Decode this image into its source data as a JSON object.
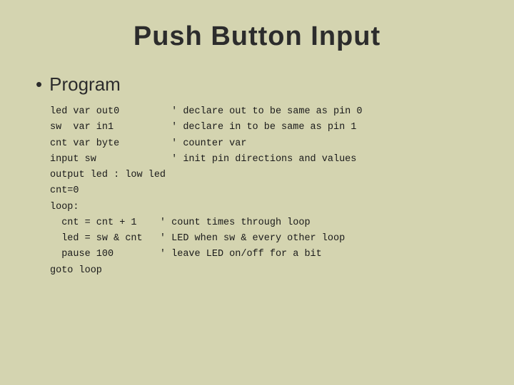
{
  "slide": {
    "title": "Push Button Input",
    "bullet": {
      "label": "Program"
    },
    "code_lines": [
      "led var out0         ' declare out to be same as pin 0",
      "sw  var in1          ' declare in to be same as pin 1",
      "cnt var byte         ' counter var",
      "input sw             ' init pin directions and values",
      "output led : low led",
      "cnt=0",
      "loop:",
      "  cnt = cnt + 1    ' count times through loop",
      "  led = sw & cnt   ' LED when sw & every other loop",
      "  pause 100        ' leave LED on/off for a bit",
      "goto loop"
    ]
  }
}
